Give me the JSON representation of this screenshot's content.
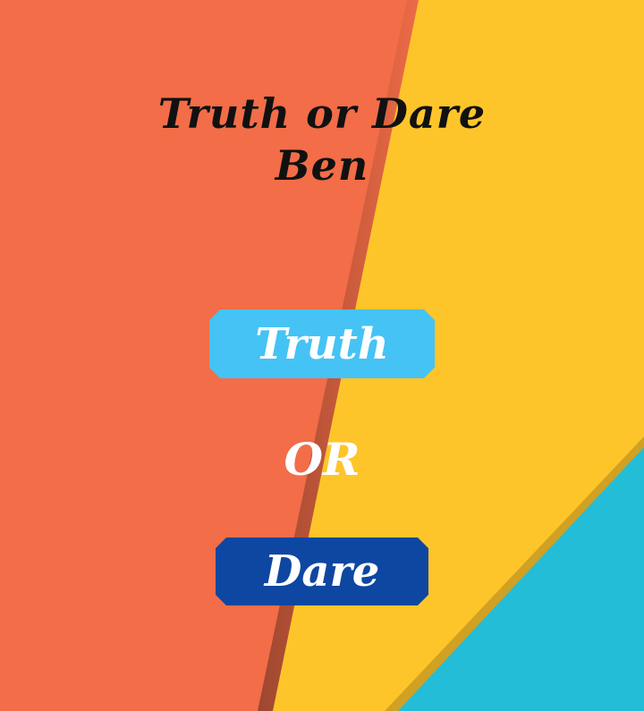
{
  "screen": {
    "title_line1": "Truth or Dare",
    "title_line2": "Ben",
    "truth_button_label": "Truth",
    "or_label": "OR",
    "dare_button_label": "Dare"
  },
  "colors": {
    "background_orange": "#F26D48",
    "background_yellow": "#FEC52A",
    "background_cyan": "#23BDD8",
    "truth_button": "#45C3F5",
    "dare_button": "#0E47A1",
    "title_text": "#111111",
    "button_text": "#FFFFFF"
  }
}
